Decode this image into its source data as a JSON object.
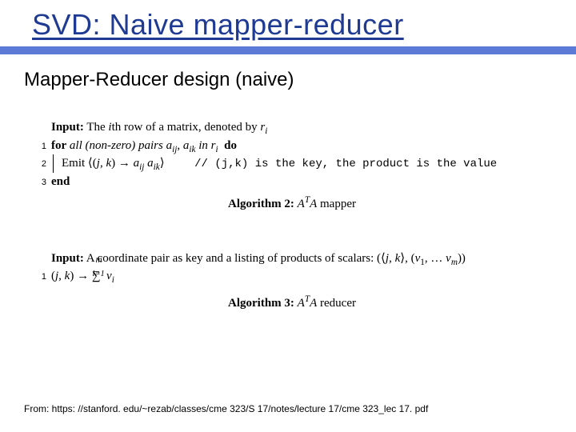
{
  "title": "SVD: Naive mapper-reducer",
  "subtitle": "Mapper-Reducer design (naive)",
  "algo1": {
    "input_label": "Input:",
    "input_text_1": " The ",
    "input_text_2": "th row of a matrix, denoted by ",
    "for_label": "for",
    "for_body_1": " all (non-zero) pairs ",
    "for_body_2": " in ",
    "do_label": "do",
    "emit_label": "Emit ",
    "comment": "// (j,k) is the key, the product is the value",
    "end_label": "end",
    "caption_label": "Algorithm 2:",
    "caption_text": " mapper"
  },
  "algo2": {
    "input_label": "Input:",
    "input_text": " A coordinate pair as key and a listing of products of scalars: ",
    "caption_label": "Algorithm 3:",
    "caption_text": " reducer"
  },
  "footer": "From: https: //stanford. edu/~rezab/classes/cme 323/S 17/notes/lecture 17/cme 323_lec 17. pdf"
}
